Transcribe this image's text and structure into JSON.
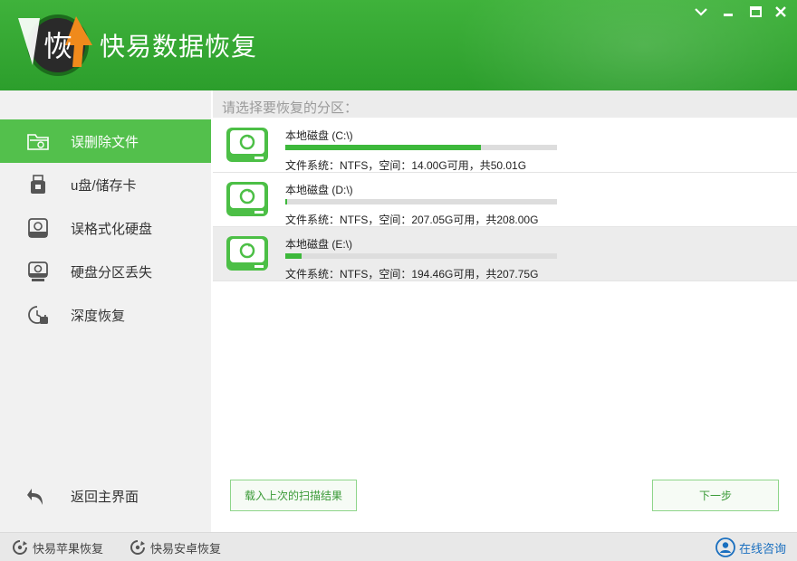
{
  "app": {
    "logo_glyph": "恢",
    "title": "快易数据恢复"
  },
  "window_controls": [
    "chevron-down-icon",
    "minimize-icon",
    "maximize-icon",
    "close-icon"
  ],
  "sidebar": {
    "items": [
      {
        "label": "误删除文件",
        "icon": "folder-icon",
        "active": true
      },
      {
        "label": "u盘/储存卡",
        "icon": "usb-icon",
        "active": false
      },
      {
        "label": "误格式化硬盘",
        "icon": "hard-disk-icon",
        "active": false
      },
      {
        "label": "硬盘分区丢失",
        "icon": "disk-partition-icon",
        "active": false
      },
      {
        "label": "深度恢复",
        "icon": "deep-recovery-icon",
        "active": false
      }
    ],
    "back_label": "返回主界面"
  },
  "main": {
    "heading": "请选择要恢复的分区：",
    "partitions": [
      {
        "name": "本地磁盘 (C:\\)",
        "info": "文件系统：NTFS，空间：14.00G可用，共50.01G",
        "used_fraction": 0.72,
        "selected": false
      },
      {
        "name": "本地磁盘 (D:\\)",
        "info": "文件系统：NTFS，空间：207.05G可用，共208.00G",
        "used_fraction": 0.005,
        "selected": false
      },
      {
        "name": "本地磁盘 (E:\\)",
        "info": "文件系统：NTFS，空间：194.46G可用，共207.75G",
        "used_fraction": 0.06,
        "selected": true
      }
    ],
    "load_last_label": "载入上次的扫描结果",
    "next_label": "下一步"
  },
  "footer": {
    "apple_label": "快易苹果恢复",
    "android_label": "快易安卓恢复",
    "consult_label": "在线咨询"
  },
  "colors": {
    "brand_green": "#3fb23b",
    "active_green": "#53c04c",
    "progress_green": "#3db83b",
    "link_blue": "#1a6fbf"
  }
}
